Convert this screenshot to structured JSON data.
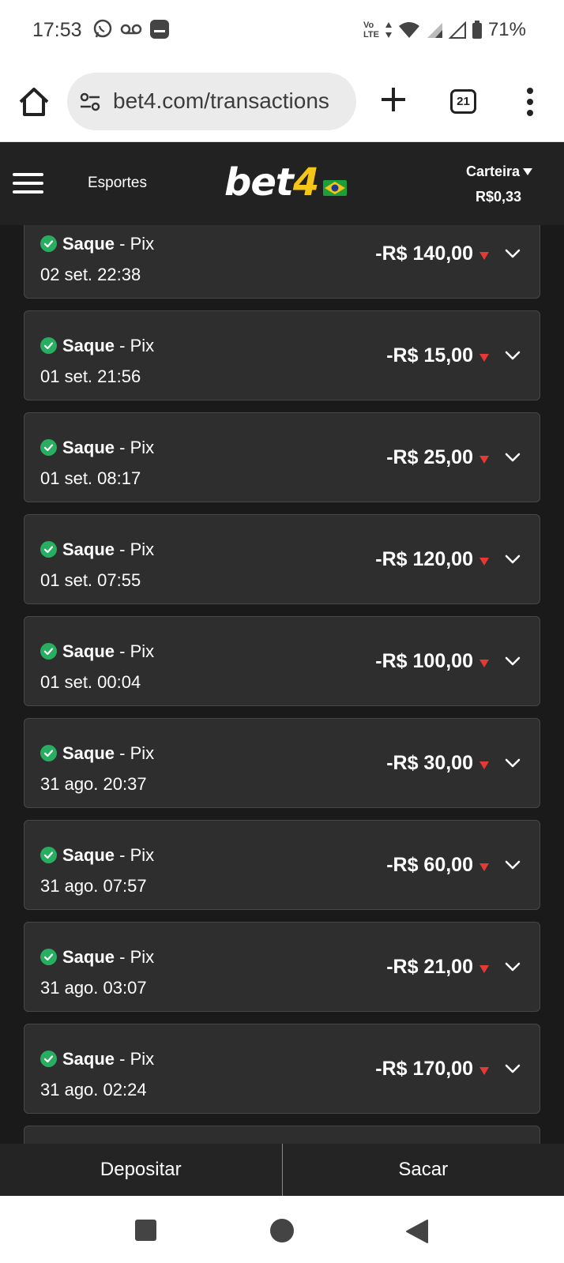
{
  "status_bar": {
    "time": "17:53",
    "network_label_top": "Vo",
    "network_label_bottom": "LTE",
    "battery": "71%",
    "icons": [
      "whatsapp-icon",
      "voicemail-icon",
      "notification-icon",
      "data-arrows-icon",
      "wifi-icon",
      "signal-icon",
      "signal-empty-icon",
      "battery-icon"
    ]
  },
  "browser": {
    "url": "bet4.com/transactions",
    "tab_count": "21"
  },
  "site_header": {
    "menu_icon": "hamburger-icon",
    "nav_link": "Esportes",
    "logo_main": "bet",
    "logo_number": "4",
    "wallet_label": "Carteira",
    "wallet_balance": "R$0,33"
  },
  "transactions": [
    {
      "type": "Saque",
      "method": " - Pix",
      "date": "02 set. 22:38",
      "amount": "-R$ 140,00"
    },
    {
      "type": "Saque",
      "method": " - Pix",
      "date": "01 set. 21:56",
      "amount": "-R$ 15,00"
    },
    {
      "type": "Saque",
      "method": " - Pix",
      "date": "01 set. 08:17",
      "amount": "-R$ 25,00"
    },
    {
      "type": "Saque",
      "method": " - Pix",
      "date": "01 set. 07:55",
      "amount": "-R$ 120,00"
    },
    {
      "type": "Saque",
      "method": " - Pix",
      "date": "01 set. 00:04",
      "amount": "-R$ 100,00"
    },
    {
      "type": "Saque",
      "method": " - Pix",
      "date": "31 ago. 20:37",
      "amount": "-R$ 30,00"
    },
    {
      "type": "Saque",
      "method": " - Pix",
      "date": "31 ago. 07:57",
      "amount": "-R$ 60,00"
    },
    {
      "type": "Saque",
      "method": " - Pix",
      "date": "31 ago. 03:07",
      "amount": "-R$ 21,00"
    },
    {
      "type": "Saque",
      "method": " - Pix",
      "date": "31 ago. 02:24",
      "amount": "-R$ 170,00"
    }
  ],
  "bottom_actions": {
    "deposit": "Depositar",
    "withdraw": "Sacar"
  },
  "colors": {
    "success": "#27ae60",
    "negative": "#e53935",
    "logo_accent": "#f5c518",
    "card_bg": "#2e2e2e",
    "header_bg": "#222222"
  }
}
